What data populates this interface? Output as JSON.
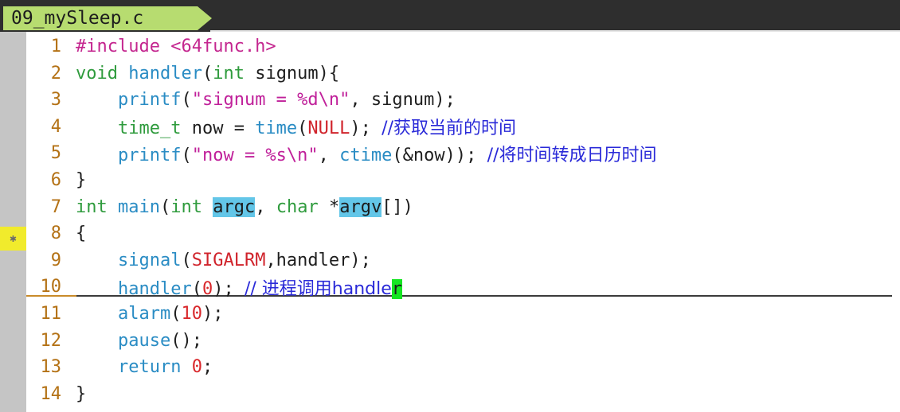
{
  "tab": {
    "label": "09_mySleep.c"
  },
  "editor": {
    "lines": [
      {
        "num": "1",
        "tokens": [
          [
            "pp",
            "#include "
          ],
          [
            "pp",
            "<64func.h>"
          ]
        ]
      },
      {
        "num": "2",
        "tokens": [
          [
            "kw",
            "void"
          ],
          [
            "plain",
            " "
          ],
          [
            "fn",
            "handler"
          ],
          [
            "plain",
            "("
          ],
          [
            "kw",
            "int"
          ],
          [
            "plain",
            " signum){"
          ]
        ]
      },
      {
        "num": "3",
        "tokens": [
          [
            "plain",
            "    "
          ],
          [
            "fn",
            "printf"
          ],
          [
            "plain",
            "("
          ],
          [
            "str",
            "\"signum = %d\\n\""
          ],
          [
            "plain",
            ", signum);"
          ]
        ]
      },
      {
        "num": "4",
        "tokens": [
          [
            "plain",
            "    "
          ],
          [
            "kw",
            "time_t"
          ],
          [
            "plain",
            " now = "
          ],
          [
            "fn",
            "time"
          ],
          [
            "plain",
            "("
          ],
          [
            "mac",
            "NULL"
          ],
          [
            "plain",
            "); "
          ],
          [
            "cm",
            "//获取当前的时间"
          ]
        ]
      },
      {
        "num": "5",
        "tokens": [
          [
            "plain",
            "    "
          ],
          [
            "fn",
            "printf"
          ],
          [
            "plain",
            "("
          ],
          [
            "str",
            "\"now = %s\\n\""
          ],
          [
            "plain",
            ", "
          ],
          [
            "fn",
            "ctime"
          ],
          [
            "plain",
            "(&now)); "
          ],
          [
            "cm",
            "//将时间转成日历时间"
          ]
        ]
      },
      {
        "num": "6",
        "tokens": [
          [
            "plain",
            "}"
          ]
        ]
      },
      {
        "num": "7",
        "tokens": [
          [
            "kw",
            "int"
          ],
          [
            "plain",
            " "
          ],
          [
            "fn",
            "main"
          ],
          [
            "plain",
            "("
          ],
          [
            "kw",
            "int"
          ],
          [
            "plain",
            " "
          ],
          [
            "hl",
            "argc"
          ],
          [
            "plain",
            ", "
          ],
          [
            "kw",
            "char"
          ],
          [
            "plain",
            " *"
          ],
          [
            "hl",
            "argv"
          ],
          [
            "plain",
            "[])"
          ]
        ]
      },
      {
        "num": "8",
        "tokens": [
          [
            "plain",
            "{"
          ]
        ]
      },
      {
        "num": "9",
        "tokens": [
          [
            "plain",
            "    "
          ],
          [
            "fn",
            "signal"
          ],
          [
            "plain",
            "("
          ],
          [
            "mac",
            "SIGALRM"
          ],
          [
            "plain",
            ",handler);"
          ]
        ]
      },
      {
        "num": "10",
        "tokens": [
          [
            "plain",
            "    "
          ],
          [
            "fn",
            "handler"
          ],
          [
            "plain",
            "("
          ],
          [
            "num",
            "0"
          ],
          [
            "plain",
            "); "
          ],
          [
            "cm",
            "// 进程调用handle"
          ],
          [
            "cur",
            "r"
          ]
        ]
      },
      {
        "num": "11",
        "tokens": [
          [
            "plain",
            "    "
          ],
          [
            "fn",
            "alarm"
          ],
          [
            "plain",
            "("
          ],
          [
            "num",
            "10"
          ],
          [
            "plain",
            ");"
          ]
        ]
      },
      {
        "num": "12",
        "tokens": [
          [
            "plain",
            "    "
          ],
          [
            "fn",
            "pause"
          ],
          [
            "plain",
            "();"
          ]
        ]
      },
      {
        "num": "13",
        "tokens": [
          [
            "plain",
            "    "
          ],
          [
            "fn",
            "return"
          ],
          [
            "plain",
            " "
          ],
          [
            "num",
            "0"
          ],
          [
            "plain",
            ";"
          ]
        ]
      },
      {
        "num": "14",
        "tokens": [
          [
            "plain",
            "}"
          ]
        ]
      }
    ]
  },
  "gutter": {
    "marker_line": "7",
    "marker_icon": "sign-marker-icon"
  },
  "colors": {
    "tab_bg": "#b7dc70",
    "tabbar_bg": "#2e2e2e",
    "line_number": "#b47216",
    "keyword": "#2f9b3d",
    "function": "#2a8cc4",
    "string": "#c0209a",
    "number": "#d9282c",
    "comment": "#2a2ad8",
    "search_highlight": "#63c6e8",
    "cursor": "#15e622",
    "gutter_marker": "#f1eb2c"
  }
}
